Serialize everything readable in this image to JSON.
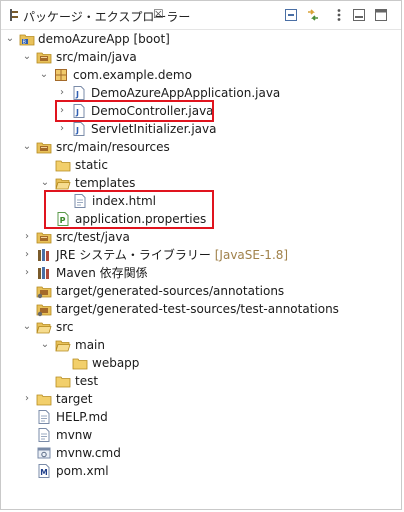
{
  "view": {
    "title": "パッケージ・エクスプローラー",
    "close_glyph": "☒"
  },
  "toolbar": {
    "collapse_all": "collapse-all-icon",
    "link_editor": "link-with-editor-icon",
    "view_menu": "view-menu-icon",
    "minimize": "minimize-icon",
    "maximize": "maximize-icon"
  },
  "tree": {
    "project": {
      "label": "demoAzureApp [boot]"
    },
    "src_main_java": {
      "label": "src/main/java"
    },
    "pkg": {
      "label": "com.example.demo"
    },
    "file_app": {
      "label": "DemoAzureAppApplication.java"
    },
    "file_controller": {
      "label": "DemoController.java"
    },
    "file_servlet": {
      "label": "ServletInitializer.java"
    },
    "src_main_resources": {
      "label": "src/main/resources"
    },
    "static": {
      "label": "static"
    },
    "templates": {
      "label": "templates"
    },
    "index_html": {
      "label": "index.html"
    },
    "app_props": {
      "label": "application.properties"
    },
    "src_test_java": {
      "label": "src/test/java"
    },
    "jre": {
      "label": "JRE システム・ライブラリー",
      "decoration": "[JavaSE-1.8]"
    },
    "maven": {
      "label": "Maven 依存関係"
    },
    "gen_sources": {
      "label": "target/generated-sources/annotations"
    },
    "gen_test_sources": {
      "label": "target/generated-test-sources/test-annotations"
    },
    "src": {
      "label": "src"
    },
    "main": {
      "label": "main"
    },
    "webapp": {
      "label": "webapp"
    },
    "test": {
      "label": "test"
    },
    "target": {
      "label": "target"
    },
    "help": {
      "label": "HELP.md"
    },
    "mvnw": {
      "label": "mvnw"
    },
    "mvnw_cmd": {
      "label": "mvnw.cmd"
    },
    "pom": {
      "label": "pom.xml"
    }
  },
  "colors": {
    "highlight": "#e0141e",
    "folder": "#e8c15a",
    "java": "#2f5fb3",
    "decoration": "#a0814a"
  }
}
